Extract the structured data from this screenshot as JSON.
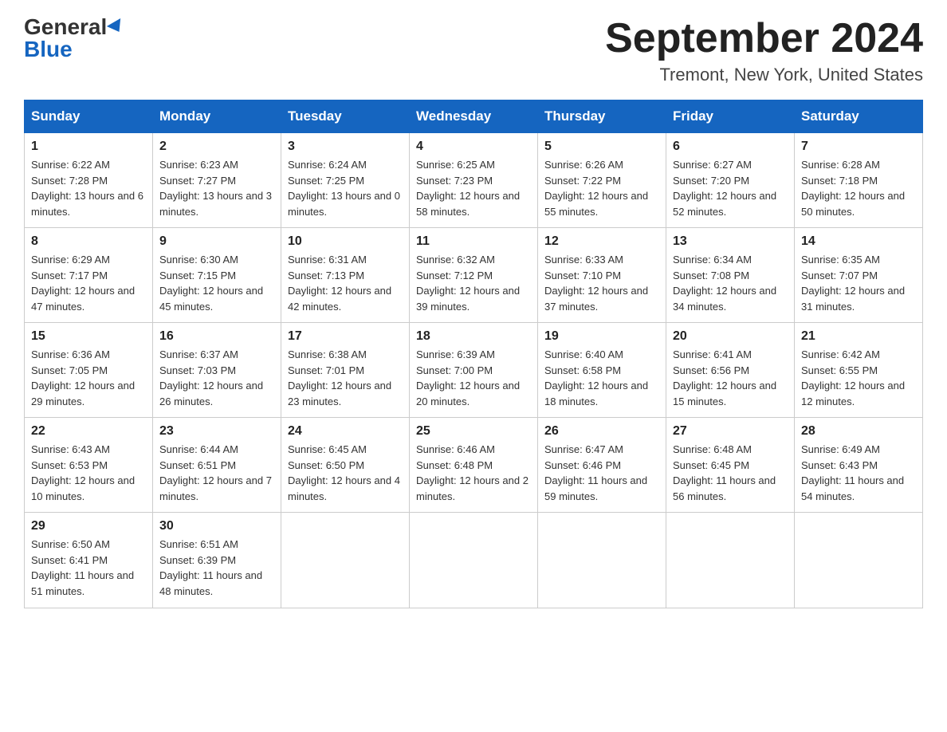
{
  "header": {
    "logo_general": "General",
    "logo_blue": "Blue",
    "month_title": "September 2024",
    "location": "Tremont, New York, United States"
  },
  "days_of_week": [
    "Sunday",
    "Monday",
    "Tuesday",
    "Wednesday",
    "Thursday",
    "Friday",
    "Saturday"
  ],
  "weeks": [
    [
      {
        "day": "1",
        "sunrise": "6:22 AM",
        "sunset": "7:28 PM",
        "daylight": "13 hours and 6 minutes."
      },
      {
        "day": "2",
        "sunrise": "6:23 AM",
        "sunset": "7:27 PM",
        "daylight": "13 hours and 3 minutes."
      },
      {
        "day": "3",
        "sunrise": "6:24 AM",
        "sunset": "7:25 PM",
        "daylight": "13 hours and 0 minutes."
      },
      {
        "day": "4",
        "sunrise": "6:25 AM",
        "sunset": "7:23 PM",
        "daylight": "12 hours and 58 minutes."
      },
      {
        "day": "5",
        "sunrise": "6:26 AM",
        "sunset": "7:22 PM",
        "daylight": "12 hours and 55 minutes."
      },
      {
        "day": "6",
        "sunrise": "6:27 AM",
        "sunset": "7:20 PM",
        "daylight": "12 hours and 52 minutes."
      },
      {
        "day": "7",
        "sunrise": "6:28 AM",
        "sunset": "7:18 PM",
        "daylight": "12 hours and 50 minutes."
      }
    ],
    [
      {
        "day": "8",
        "sunrise": "6:29 AM",
        "sunset": "7:17 PM",
        "daylight": "12 hours and 47 minutes."
      },
      {
        "day": "9",
        "sunrise": "6:30 AM",
        "sunset": "7:15 PM",
        "daylight": "12 hours and 45 minutes."
      },
      {
        "day": "10",
        "sunrise": "6:31 AM",
        "sunset": "7:13 PM",
        "daylight": "12 hours and 42 minutes."
      },
      {
        "day": "11",
        "sunrise": "6:32 AM",
        "sunset": "7:12 PM",
        "daylight": "12 hours and 39 minutes."
      },
      {
        "day": "12",
        "sunrise": "6:33 AM",
        "sunset": "7:10 PM",
        "daylight": "12 hours and 37 minutes."
      },
      {
        "day": "13",
        "sunrise": "6:34 AM",
        "sunset": "7:08 PM",
        "daylight": "12 hours and 34 minutes."
      },
      {
        "day": "14",
        "sunrise": "6:35 AM",
        "sunset": "7:07 PM",
        "daylight": "12 hours and 31 minutes."
      }
    ],
    [
      {
        "day": "15",
        "sunrise": "6:36 AM",
        "sunset": "7:05 PM",
        "daylight": "12 hours and 29 minutes."
      },
      {
        "day": "16",
        "sunrise": "6:37 AM",
        "sunset": "7:03 PM",
        "daylight": "12 hours and 26 minutes."
      },
      {
        "day": "17",
        "sunrise": "6:38 AM",
        "sunset": "7:01 PM",
        "daylight": "12 hours and 23 minutes."
      },
      {
        "day": "18",
        "sunrise": "6:39 AM",
        "sunset": "7:00 PM",
        "daylight": "12 hours and 20 minutes."
      },
      {
        "day": "19",
        "sunrise": "6:40 AM",
        "sunset": "6:58 PM",
        "daylight": "12 hours and 18 minutes."
      },
      {
        "day": "20",
        "sunrise": "6:41 AM",
        "sunset": "6:56 PM",
        "daylight": "12 hours and 15 minutes."
      },
      {
        "day": "21",
        "sunrise": "6:42 AM",
        "sunset": "6:55 PM",
        "daylight": "12 hours and 12 minutes."
      }
    ],
    [
      {
        "day": "22",
        "sunrise": "6:43 AM",
        "sunset": "6:53 PM",
        "daylight": "12 hours and 10 minutes."
      },
      {
        "day": "23",
        "sunrise": "6:44 AM",
        "sunset": "6:51 PM",
        "daylight": "12 hours and 7 minutes."
      },
      {
        "day": "24",
        "sunrise": "6:45 AM",
        "sunset": "6:50 PM",
        "daylight": "12 hours and 4 minutes."
      },
      {
        "day": "25",
        "sunrise": "6:46 AM",
        "sunset": "6:48 PM",
        "daylight": "12 hours and 2 minutes."
      },
      {
        "day": "26",
        "sunrise": "6:47 AM",
        "sunset": "6:46 PM",
        "daylight": "11 hours and 59 minutes."
      },
      {
        "day": "27",
        "sunrise": "6:48 AM",
        "sunset": "6:45 PM",
        "daylight": "11 hours and 56 minutes."
      },
      {
        "day": "28",
        "sunrise": "6:49 AM",
        "sunset": "6:43 PM",
        "daylight": "11 hours and 54 minutes."
      }
    ],
    [
      {
        "day": "29",
        "sunrise": "6:50 AM",
        "sunset": "6:41 PM",
        "daylight": "11 hours and 51 minutes."
      },
      {
        "day": "30",
        "sunrise": "6:51 AM",
        "sunset": "6:39 PM",
        "daylight": "11 hours and 48 minutes."
      },
      null,
      null,
      null,
      null,
      null
    ]
  ]
}
